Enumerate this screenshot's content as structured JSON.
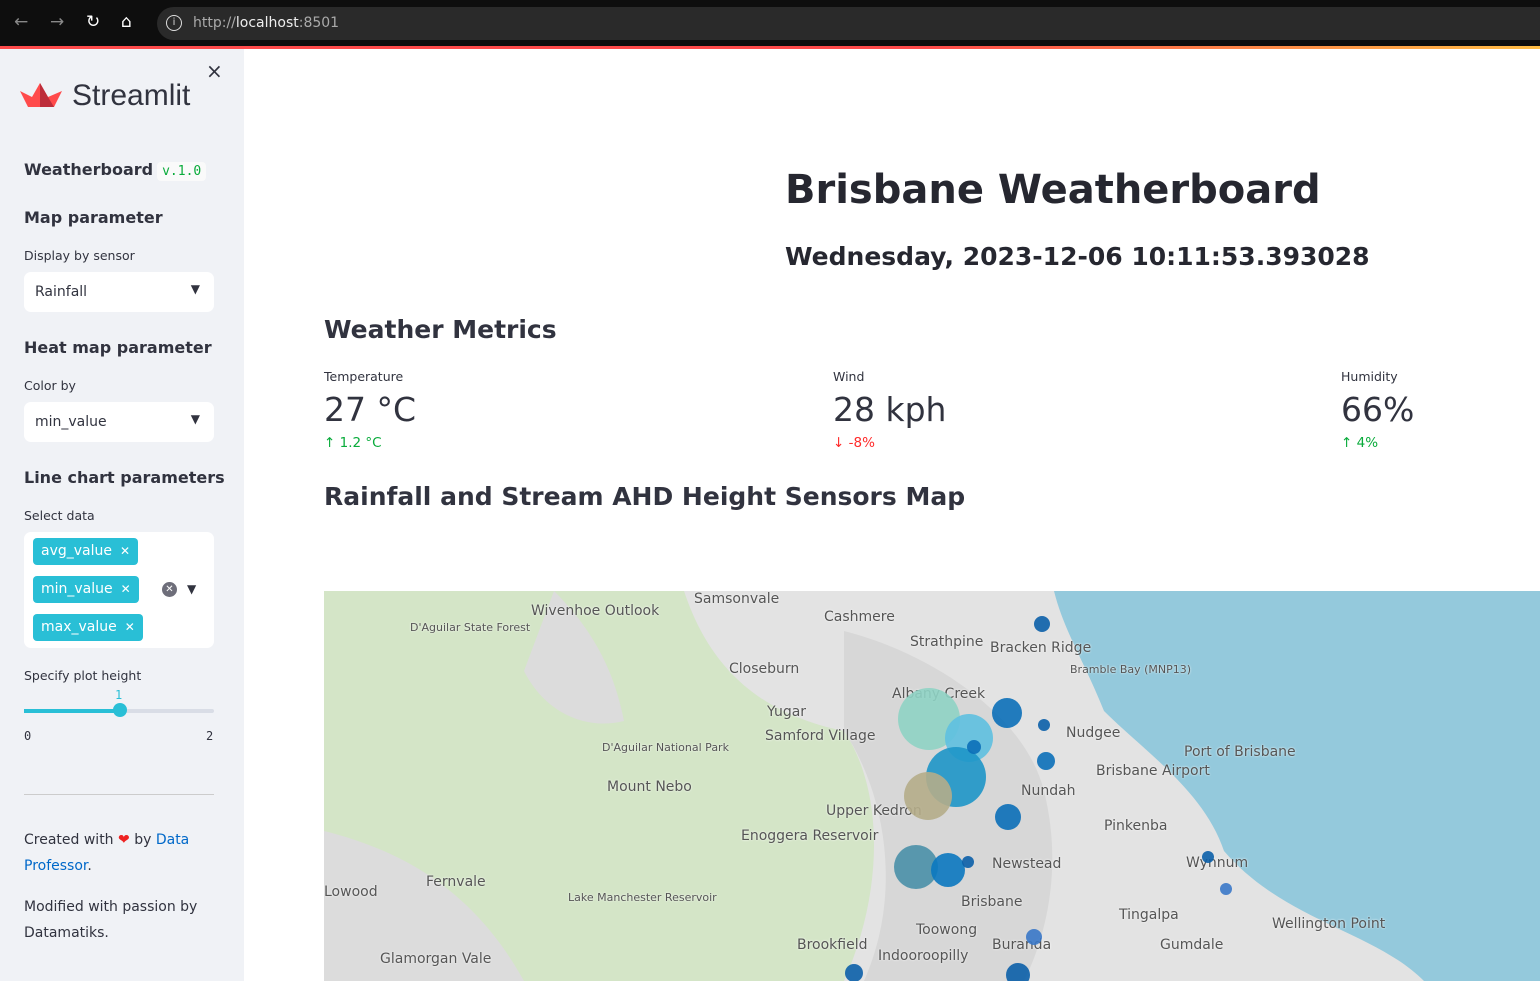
{
  "browser": {
    "url_prefix": "http://",
    "url_host": "localhost",
    "url_port": ":8501"
  },
  "sidebar": {
    "close": "×",
    "logo_text": "Streamlit",
    "app_title": "Weatherboard",
    "version": "v.1.0",
    "map_header": "Map parameter",
    "display_label": "Display by sensor",
    "display_value": "Rainfall",
    "heat_header": "Heat map parameter",
    "color_label": "Color by",
    "color_value": "min_value",
    "line_header": "Line chart parameters",
    "select_label": "Select data",
    "tags": [
      "avg_value",
      "min_value",
      "max_value"
    ],
    "slider_label": "Specify plot height",
    "slider_value": "1",
    "slider_min": "0",
    "slider_max": "2",
    "credit_prefix": "Created with",
    "credit_by": "by",
    "credit_link1": "Data",
    "credit_link2": "Professor",
    "credit_suffix": ".",
    "modified": "Modified with passion by Datamatiks."
  },
  "main": {
    "title": "Brisbane Weatherboard",
    "date": "Wednesday, 2023-12-06 10:11:53.393028",
    "metrics_header": "Weather Metrics",
    "metrics": [
      {
        "label": "Temperature",
        "value": "27 °C",
        "delta": "1.2 °C",
        "dir": "up"
      },
      {
        "label": "Wind",
        "value": "28 kph",
        "delta": "-8%",
        "dir": "down"
      },
      {
        "label": "Humidity",
        "value": "66%",
        "delta": "4%",
        "dir": "up"
      }
    ],
    "map_header": "Rainfall and Stream AHD Height Sensors Map",
    "map_labels": [
      "Samsonvale",
      "Wivenhoe Outlook",
      "Cashmere",
      "Strathpine",
      "Bracken Ridge",
      "Closeburn",
      "Albany Creek",
      "Yugar",
      "Samford Village",
      "Nudgee",
      "Brisbane Airport",
      "Port of Brisbane",
      "Mount Nebo",
      "Upper Kedron",
      "Enoggera Reservoir",
      "Pinkenba",
      "Newstead",
      "Wynnum",
      "Lowood",
      "Fernvale",
      "Brisbane",
      "Tingalpa",
      "Wellington Point",
      "Toowong",
      "Brookfield",
      "Gumdale",
      "Indooroopilly",
      "Buranda",
      "Glamorgan Vale",
      "Nundah",
      "D'Aguilar State Forest",
      "D'Aguilar National Park",
      "Lake Manchester Reservoir",
      "Bramble Bay (MNP13)"
    ]
  }
}
